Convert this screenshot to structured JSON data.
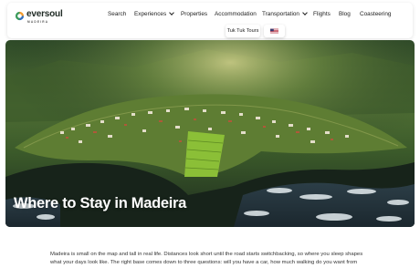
{
  "brand": {
    "name": "eversoul",
    "tagline": "MADEIRA",
    "colors": {
      "mark_green": "#3a9a5b",
      "mark_orange": "#f39a2b",
      "mark_blue": "#2f6fc0"
    }
  },
  "nav": {
    "items": [
      {
        "label": "Search",
        "dropdown": false
      },
      {
        "label": "Experiences",
        "dropdown": true
      },
      {
        "label": "Properties",
        "dropdown": false
      },
      {
        "label": "Accommodation",
        "dropdown": false
      },
      {
        "label": "Transportation",
        "dropdown": true
      },
      {
        "label": "Flights",
        "dropdown": false
      },
      {
        "label": "Blog",
        "dropdown": false
      },
      {
        "label": "Coasteering",
        "dropdown": false
      }
    ],
    "tuk_tuk_label": "Tuk Tuk Tours",
    "language_icon": "us-flag-icon"
  },
  "hero": {
    "title": "Where to Stay in Madeira",
    "image_icon": "aerial-village-photo"
  },
  "article": {
    "intro": "Madeira is small on the map and tall in real life. Distances look short until the road starts switchbacking, so where you sleep shapes what your days look like. The right base comes down to three questions: will you have a car, how much walking do you want from"
  }
}
